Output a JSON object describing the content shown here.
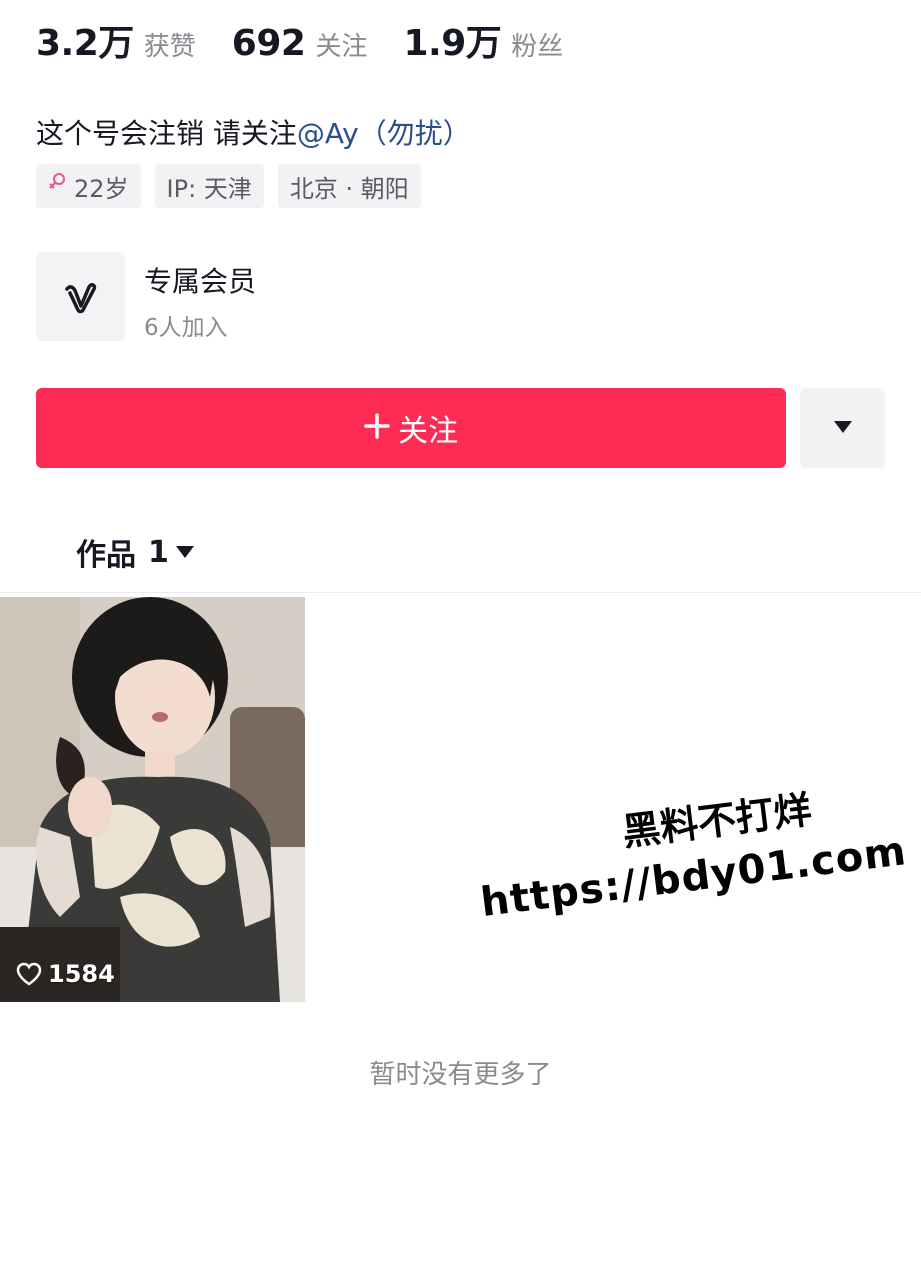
{
  "stats": [
    {
      "value": "3.2万",
      "label": "获赞"
    },
    {
      "value": "692",
      "label": "关注"
    },
    {
      "value": "1.9万",
      "label": "粉丝"
    }
  ],
  "bio": {
    "text": "这个号会注销 请关注",
    "mention": "@Ay",
    "suffix": "（勿扰）"
  },
  "tags": {
    "age": "22岁",
    "ip": "IP: 天津",
    "location": "北京 · 朝阳"
  },
  "membership": {
    "title": "专属会员",
    "subtitle": "6人加入"
  },
  "follow": {
    "label": "关注",
    "color": "#fe2c55"
  },
  "works": {
    "label": "作品",
    "count": "1"
  },
  "video": {
    "likes": "1584"
  },
  "watermark": {
    "line1": "黑料不打烊",
    "line2": "https://bdy01.com"
  },
  "end_text": "暂时没有更多了",
  "icons": [
    "female-icon",
    "member-v-icon",
    "plus-icon",
    "caret-down-icon",
    "heart-icon"
  ]
}
